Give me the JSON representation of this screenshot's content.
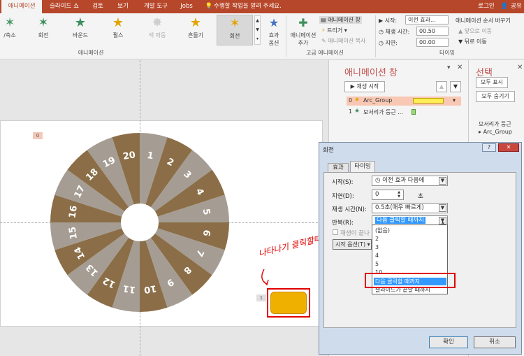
{
  "tabs": [
    {
      "label": "애니메이션",
      "active": true
    },
    {
      "label": "슬라이드 쇼"
    },
    {
      "label": "검토"
    },
    {
      "label": "보기"
    },
    {
      "label": "개발 도구"
    },
    {
      "label": "Jobs"
    }
  ],
  "tell_me": "수행할 작업을 알려 주세요.",
  "login": "로그인",
  "share": "공유",
  "animations": [
    {
      "label": "/축소"
    },
    {
      "label": "회전"
    },
    {
      "label": "바운드"
    },
    {
      "label": "펄스"
    },
    {
      "label": "색 파동"
    },
    {
      "label": "흔들기"
    },
    {
      "label": "회전",
      "selected": true
    }
  ],
  "effect_options": {
    "line1": "효과",
    "line2": "옵션"
  },
  "add_animation": {
    "line1": "애니메이션",
    "line2": "추가"
  },
  "advanced": {
    "pane": "애니메이션 창",
    "trigger": "트리거",
    "painter": "애니메이션 복사"
  },
  "timing": {
    "start_label": "시작:",
    "start_value": "이전 효과...",
    "duration_label": "재생 시간:",
    "duration_value": "00.50",
    "delay_label": "지연:",
    "delay_value": "00.00",
    "reorder_title": "애니메이션 순서 바꾸기",
    "move_earlier": "앞으로 이동",
    "move_later": "뒤로 이동"
  },
  "group_labels": {
    "animation": "애니메이션",
    "advanced": "고급 애니메이션",
    "timing": "타이밍"
  },
  "anim_pane": {
    "title": "애니메이션 창",
    "play_button": "재생 시작",
    "items": [
      {
        "num": "0",
        "name": "Arc_Group"
      },
      {
        "num": "1",
        "name": "모서리가 둥근 ..."
      }
    ]
  },
  "sel_pane": {
    "title": "선택",
    "show_all": "모두 표시",
    "hide_all": "모두 숨기기",
    "item1": "모서리가 둥근",
    "item2": "Arc_Group"
  },
  "slide": {
    "tag_top": "0",
    "tag_rect": "1",
    "wheel_numbers": [
      "1",
      "2",
      "3",
      "4",
      "5",
      "6",
      "7",
      "8",
      "9",
      "10",
      "11",
      "12",
      "13",
      "14",
      "15",
      "16",
      "17",
      "18",
      "19",
      "20"
    ],
    "annotation": "나타나기 클릭할때"
  },
  "colors": {
    "wheel_dark": "#8b6e47",
    "wheel_light": "#a59d93",
    "ribbon": "#b7472a",
    "button": "#f0b000"
  },
  "dialog": {
    "title": "회전",
    "tabs": [
      "효과",
      "타이밍"
    ],
    "start_label": "시작(S):",
    "start_value": "이전 효과 다음에",
    "delay_label": "지연(D):",
    "delay_value": "0",
    "delay_unit": "초",
    "duration_label": "재생 시간(N):",
    "duration_value": "0.5초(매우 빠르게)",
    "repeat_label": "반복(R):",
    "repeat_value": "다음 클릭할 때까지",
    "rewind_label": "재생이 끝나",
    "trigger_button": "시작 옵션(T)",
    "repeat_options": [
      "(없음)",
      "2",
      "3",
      "4",
      "5",
      "10",
      "다음 클릭할 때까지",
      "슬라이드가 끝날 때까지"
    ],
    "ok": "확인",
    "cancel": "취소"
  }
}
